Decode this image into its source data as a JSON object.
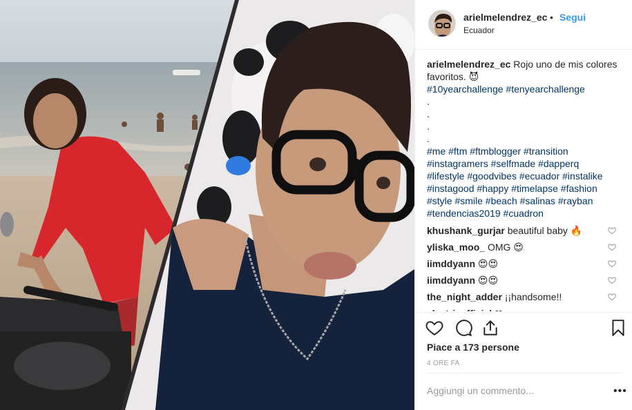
{
  "header": {
    "username": "arielmelendrez_ec",
    "separator": "•",
    "follow_label": "Segui",
    "location": "Ecuador"
  },
  "caption": {
    "username": "arielmelendrez_ec",
    "text": "Rojo uno de mis colores favoritos.",
    "emoji": "😈",
    "tags_line1": "#10yearchallenge #tenyearchallenge",
    "dots": [
      ".",
      ".",
      ".",
      "."
    ],
    "tags_line2": "#me #ftm #ftmblogger #transition",
    "tags_line3": "#instagramers #selfmade #dapperq",
    "tags_line4": "#lifestyle #goodvibes #ecuador #instalike",
    "tags_line5": "#instagood #happy #timelapse #fashion",
    "tags_line6": "#style #smile #beach #salinas #rayban",
    "tags_line7": "#tendencias2019 #cuadron"
  },
  "comments": [
    {
      "user": "khushank_gurjar",
      "text": "beautiful baby 🔥"
    },
    {
      "user": "yliska_moo_",
      "text": "OMG 😍"
    },
    {
      "user": "iimddyann",
      "text": "😍😍"
    },
    {
      "user": "iimddyann",
      "text": "😍😍"
    },
    {
      "user": "the_night_adder",
      "text": "¡¡handsome!!"
    },
    {
      "user": "electricofficial",
      "text": "❤"
    }
  ],
  "likes_text": "Piace a 173 persone",
  "time_text": "4 ORE FA",
  "add_comment_placeholder": "Aggiungi un commento...",
  "more_label": "•••",
  "icons": {
    "like": "heart-icon",
    "comment": "comment-icon",
    "share": "share-icon",
    "save": "bookmark-icon",
    "comment_like": "heart-outline-icon"
  },
  "colors": {
    "follow": "#3897f0",
    "hashtag": "#003569",
    "muted": "#999999"
  }
}
